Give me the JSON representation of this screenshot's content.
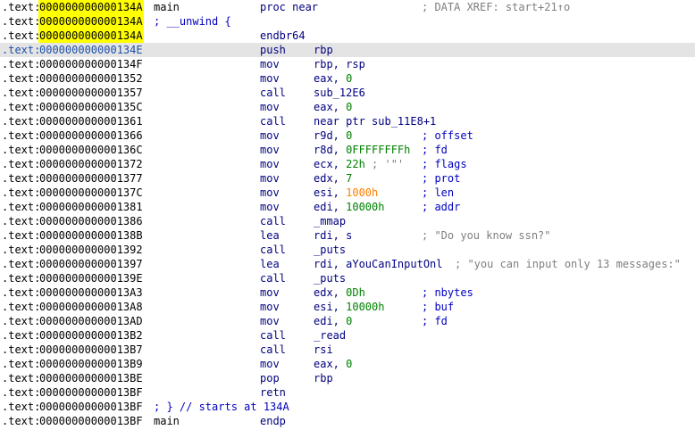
{
  "segment": ".text:",
  "rows": [
    {
      "addr": "000000000000134A",
      "label": "main",
      "mnem": "proc near",
      "xref": "; DATA XREF: start+21↑o"
    },
    {
      "addr": "000000000000134A",
      "meta": "; __unwind {"
    },
    {
      "addr": "000000000000134A",
      "mnem": "endbr64"
    },
    {
      "addr": "000000000000134E",
      "mnem": "push",
      "op": "rbp"
    },
    {
      "addr": "000000000000134F",
      "mnem": "mov",
      "op": "rbp, rsp"
    },
    {
      "addr": "0000000000001352",
      "mnem": "mov",
      "op1": "eax, ",
      "op2": "0"
    },
    {
      "addr": "0000000000001357",
      "mnem": "call",
      "op": "sub_12E6"
    },
    {
      "addr": "000000000000135C",
      "mnem": "mov",
      "op1": "eax, ",
      "op2": "0"
    },
    {
      "addr": "0000000000001361",
      "mnem": "call",
      "op": "near ptr sub_11E8+1"
    },
    {
      "addr": "0000000000001366",
      "mnem": "mov",
      "op1": "r9d, ",
      "op2": "0",
      "comment": "; offset"
    },
    {
      "addr": "000000000000136C",
      "mnem": "mov",
      "op1": "r8d, ",
      "op2": "0FFFFFFFFh",
      "comment": "; fd"
    },
    {
      "addr": "0000000000001372",
      "mnem": "mov",
      "op1": "ecx, ",
      "op2": "22h",
      "op3": " ; '\"'",
      "comment": "; flags"
    },
    {
      "addr": "0000000000001377",
      "mnem": "mov",
      "op1": "edx, ",
      "op2": "7",
      "comment": "; prot"
    },
    {
      "addr": "000000000000137C",
      "mnem": "mov",
      "op1": "esi, ",
      "op2": "1000h",
      "comment": "; len"
    },
    {
      "addr": "0000000000001381",
      "mnem": "mov",
      "op1": "edi, ",
      "op2": "10000h",
      "comment": "; addr"
    },
    {
      "addr": "0000000000001386",
      "mnem": "call",
      "op": "_mmap"
    },
    {
      "addr": "000000000000138B",
      "mnem": "lea",
      "op": "rdi, s",
      "comment": "; \"Do you know ssn?\""
    },
    {
      "addr": "0000000000001392",
      "mnem": "call",
      "op": "_puts"
    },
    {
      "addr": "0000000000001397",
      "mnem": "lea",
      "op": "rdi, aYouCanInputOnl",
      "inline_comment": "; \"you can input only 13 messages:\""
    },
    {
      "addr": "000000000000139E",
      "mnem": "call",
      "op": "_puts"
    },
    {
      "addr": "00000000000013A3",
      "mnem": "mov",
      "op1": "edx, ",
      "op2": "0Dh",
      "comment": "; nbytes"
    },
    {
      "addr": "00000000000013A8",
      "mnem": "mov",
      "op1": "esi, ",
      "op2": "10000h",
      "comment": "; buf"
    },
    {
      "addr": "00000000000013AD",
      "mnem": "mov",
      "op1": "edi, ",
      "op2": "0",
      "comment": "; fd"
    },
    {
      "addr": "00000000000013B2",
      "mnem": "call",
      "op": "_read"
    },
    {
      "addr": "00000000000013B7",
      "mnem": "call",
      "op": "rsi"
    },
    {
      "addr": "00000000000013B9",
      "mnem": "mov",
      "op1": "eax, ",
      "op2": "0"
    },
    {
      "addr": "00000000000013BE",
      "mnem": "pop",
      "op": "rbp"
    },
    {
      "addr": "00000000000013BF",
      "mnem": "retn"
    },
    {
      "addr": "00000000000013BF",
      "meta": "; } // starts at 134A"
    },
    {
      "addr": "00000000000013BF",
      "label": "main",
      "mnem": "endp"
    }
  ],
  "highlight_rows": [
    3
  ],
  "yellow_rows": [
    0,
    1,
    2
  ],
  "colors": {
    "highlight": "#e4e4e4",
    "yellow": "#ffff00",
    "mnemonic": "#000080",
    "number": "#008000",
    "orange_number": "#ff8000",
    "comment": "#0000c0"
  }
}
